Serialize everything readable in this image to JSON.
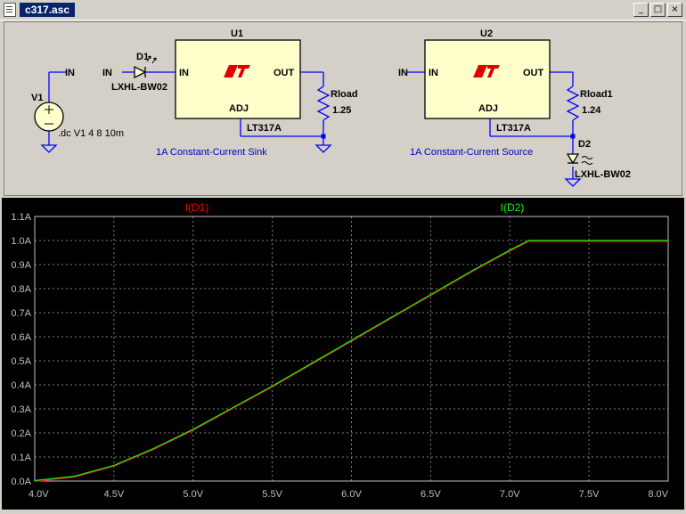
{
  "window": {
    "title": "c317.asc",
    "minimize_glyph": "_",
    "maximize_glyph": "□",
    "close_glyph": "×"
  },
  "schematic": {
    "source": {
      "name": "V1",
      "net": "IN",
      "directive": ".dc V1 4 8 10m"
    },
    "circuit1": {
      "regulator": {
        "name": "U1",
        "part": "LT317A",
        "pin_in": "IN",
        "pin_out": "OUT",
        "pin_adj": "ADJ"
      },
      "input_net": "IN",
      "diode": {
        "name": "D1",
        "part": "LXHL-BW02"
      },
      "resistor": {
        "name": "Rload",
        "value": "1.25"
      },
      "caption": "1A Constant-Current Sink"
    },
    "circuit2": {
      "regulator": {
        "name": "U2",
        "part": "LT317A",
        "pin_in": "IN",
        "pin_out": "OUT",
        "pin_adj": "ADJ"
      },
      "input_net": "IN",
      "resistor": {
        "name": "Rload1",
        "value": "1.24"
      },
      "diode": {
        "name": "D2",
        "part": "LXHL-BW02"
      },
      "caption": "1A Constant-Current Source"
    },
    "colors": {
      "wire": "#0000ff",
      "ground": "#0000ff",
      "body": "#ffffcc",
      "caption": "#0000c0"
    }
  },
  "chart_data": {
    "type": "line",
    "x": [
      4.0,
      4.25,
      4.5,
      4.75,
      5.0,
      5.25,
      5.5,
      5.75,
      6.0,
      6.25,
      6.5,
      6.75,
      7.0,
      7.12,
      7.5,
      8.0
    ],
    "series": [
      {
        "name": "I(D1)",
        "color": "#ff0000",
        "values": [
          0.002,
          0.02,
          0.065,
          0.135,
          0.215,
          0.305,
          0.395,
          0.49,
          0.585,
          0.68,
          0.775,
          0.87,
          0.96,
          1.0,
          1.0,
          1.0
        ]
      },
      {
        "name": "I(D2)",
        "color": "#00ff00",
        "values": [
          0.002,
          0.02,
          0.065,
          0.135,
          0.215,
          0.305,
          0.395,
          0.49,
          0.585,
          0.68,
          0.775,
          0.87,
          0.96,
          1.0,
          1.0,
          1.0
        ]
      }
    ],
    "xlim": [
      4.0,
      8.0
    ],
    "ylim": [
      0.0,
      1.1
    ],
    "xticks": [
      4.0,
      4.5,
      5.0,
      5.5,
      6.0,
      6.5,
      7.0,
      7.5,
      8.0
    ],
    "xtick_labels": [
      "4.0V",
      "4.5V",
      "5.0V",
      "5.5V",
      "6.0V",
      "6.5V",
      "7.0V",
      "7.5V",
      "8.0V"
    ],
    "yticks": [
      0.0,
      0.1,
      0.2,
      0.3,
      0.4,
      0.5,
      0.6,
      0.7,
      0.8,
      0.9,
      1.0,
      1.1
    ],
    "ytick_labels": [
      "0.0A",
      "0.1A",
      "0.2A",
      "0.3A",
      "0.4A",
      "0.5A",
      "0.6A",
      "0.7A",
      "0.8A",
      "0.9A",
      "1.0A",
      "1.1A"
    ],
    "grid": true,
    "legend": "top"
  }
}
